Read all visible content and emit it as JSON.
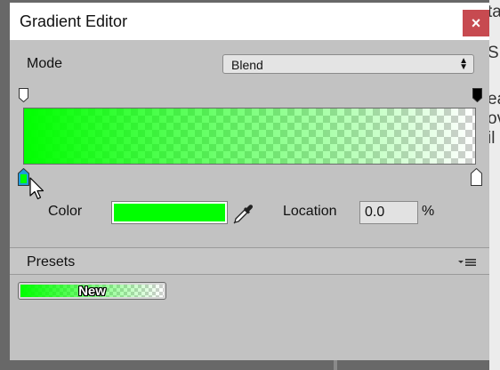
{
  "window": {
    "title": "Gradient Editor",
    "close_glyph": "×"
  },
  "mode": {
    "label": "Mode",
    "value": "Blend"
  },
  "gradient": {
    "color_start": "#00ff00",
    "alpha_start": 1.0,
    "alpha_end": 0.0,
    "alpha_keys": [
      {
        "location": 0.0,
        "alpha": 1.0
      },
      {
        "location": 1.0,
        "alpha": 0.0
      }
    ],
    "color_keys": [
      {
        "location": 0.0,
        "color": "#00ff00",
        "selected": true
      },
      {
        "location": 1.0,
        "color": "#ffffff",
        "selected": false
      }
    ]
  },
  "color_field": {
    "label": "Color",
    "value": "#00ff00",
    "eyedropper_icon": "eyedropper-icon"
  },
  "location_field": {
    "label": "Location",
    "value": "0.0",
    "unit": "%"
  },
  "presets": {
    "label": "Presets",
    "menu_icon": "dropdown-menu-icon",
    "items": [
      {
        "label": "New"
      }
    ]
  },
  "background": {
    "glyphs": [
      "ta",
      "S",
      "ea",
      "ov",
      "il"
    ]
  }
}
